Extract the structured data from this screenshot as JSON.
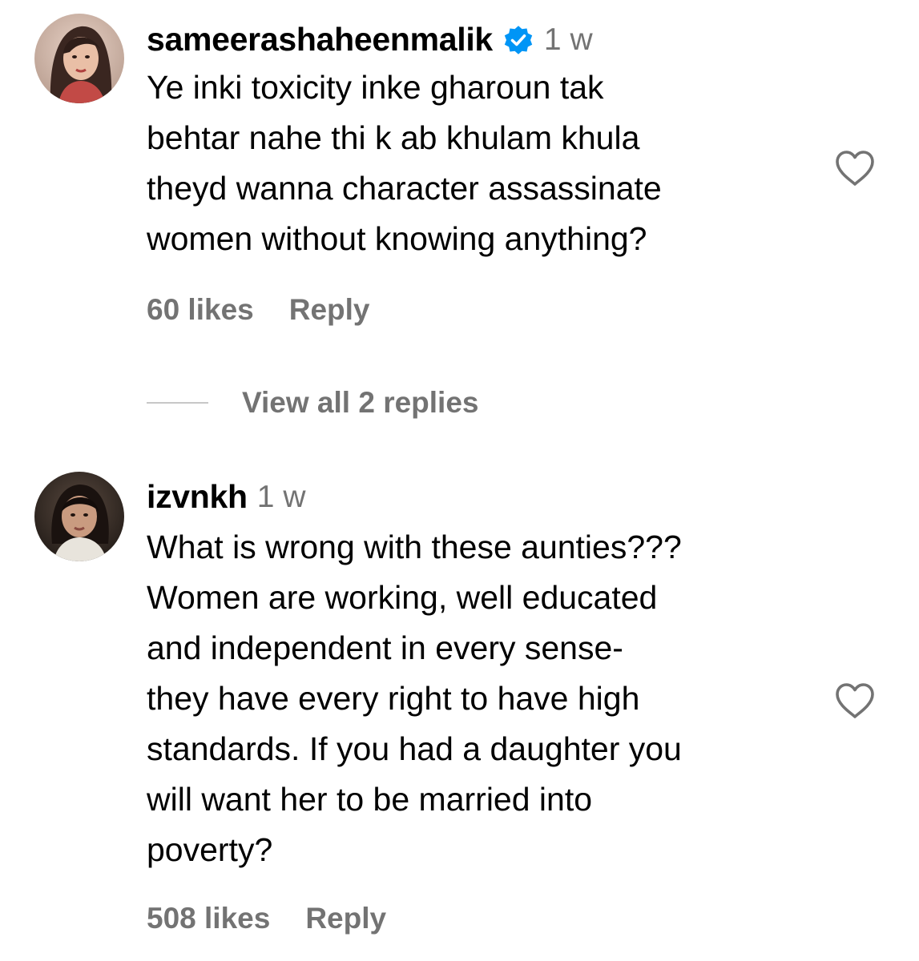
{
  "comments": [
    {
      "username": "sameerashaheenmalik",
      "verified": true,
      "time": "1 w",
      "avatar_icon": "profile-photo",
      "text": "Ye inki toxicity inke gharoun tak\nbehtar nahe thi k ab khulam khula\ntheyd wanna character assassinate\nwomen without knowing anything?",
      "likes": "60 likes",
      "reply_label": "Reply",
      "view_replies_label": "View all 2 replies",
      "like_icon": "heart-outline-icon"
    },
    {
      "username": "izvnkh",
      "verified": false,
      "time": "1 w",
      "avatar_icon": "profile-photo",
      "text": "What is wrong with these aunties???\nWomen are working, well educated\nand independent in every sense-\nthey have every right to have high\nstandards. If you had a daughter you\nwill want her to be married into\npoverty?",
      "likes": "508 likes",
      "reply_label": "Reply",
      "like_icon": "heart-outline-icon"
    }
  ],
  "colors": {
    "text": "#000000",
    "secondary": "#737373",
    "verified_badge": "#0095f6",
    "divider": "#c7c7c7"
  }
}
